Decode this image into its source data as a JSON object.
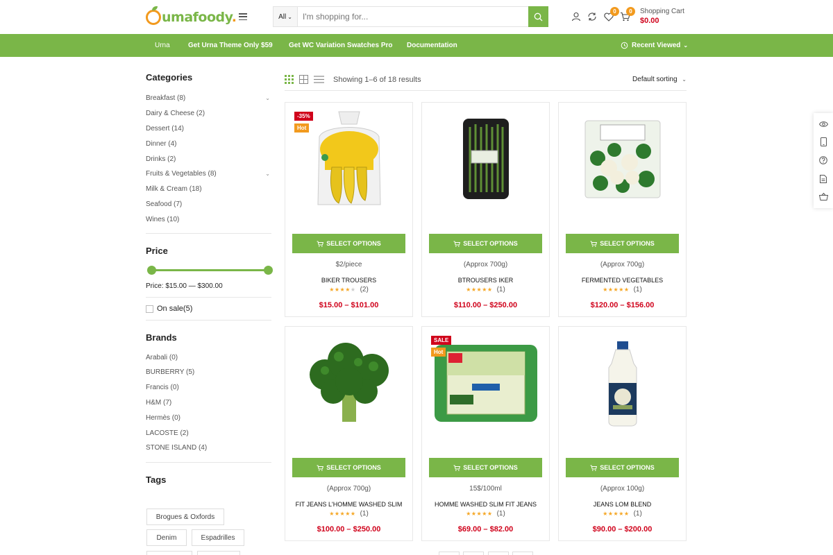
{
  "brand": {
    "name_main": "umafoody",
    "name_dot": "."
  },
  "search": {
    "category": "All",
    "placeholder": "I'm shopping for..."
  },
  "header": {
    "compare_count": "0",
    "wishlist_count": "0",
    "cart_count": "0",
    "cart_title": "Shopping Cart",
    "cart_total": "$0.00"
  },
  "nav": {
    "items": [
      "Urna",
      "Get Urna Theme Only $59",
      "Get WC Variation Swatches Pro",
      "Documentation"
    ],
    "recent": "Recent Viewed"
  },
  "sidebar": {
    "categories_title": "Categories",
    "categories": [
      {
        "label": "Breakfast (8)",
        "expandable": true
      },
      {
        "label": "Dairy & Cheese (2)",
        "expandable": false
      },
      {
        "label": "Dessert (14)",
        "expandable": false
      },
      {
        "label": "Dinner (4)",
        "expandable": false
      },
      {
        "label": "Drinks (2)",
        "expandable": false
      },
      {
        "label": "Fruits & Vegetables (8)",
        "expandable": true
      },
      {
        "label": "Milk & Cream (18)",
        "expandable": false
      },
      {
        "label": "Seafood (7)",
        "expandable": false
      },
      {
        "label": "Wines (10)",
        "expandable": false
      }
    ],
    "price_title": "Price",
    "price_range": "Price: $15.00 — $300.00",
    "on_sale": "On sale(5)",
    "brands_title": "Brands",
    "brands": [
      "Arabali (0)",
      "BURBERRY (5)",
      "Francis (0)",
      "H&M (7)",
      "Hermès (0)",
      "LACOSTE (2)",
      "STONE ISLAND (4)"
    ],
    "tags_title": "Tags",
    "tags": [
      "Brogues & Oxfords",
      "Denim",
      "Espadrilles"
    ]
  },
  "toolbar": {
    "result_count": "Showing 1–6 of 18 results",
    "sorting": "Default sorting"
  },
  "products": [
    {
      "unit": "$2/piece",
      "name": "BIKER TROUSERS",
      "rating": 4,
      "reviews": "(2)",
      "price": "$15.00 – $101.00",
      "labels": [
        "-35%",
        "Hot"
      ],
      "button": "SELECT OPTIONS"
    },
    {
      "unit": "(Approx 700g)",
      "name": "BTROUSERS IKER",
      "rating": 5,
      "reviews": "(1)",
      "price": "$110.00 – $250.00",
      "labels": [],
      "button": "SELECT OPTIONS"
    },
    {
      "unit": "(Approx 700g)",
      "name": "FERMENTED VEGETABLES",
      "rating": 5,
      "reviews": "(1)",
      "price": "$120.00 – $156.00",
      "labels": [],
      "button": "SELECT OPTIONS"
    },
    {
      "unit": "(Approx 700g)",
      "name": "FIT JEANS L'HOMME WASHED SLIM",
      "rating": 5,
      "reviews": "(1)",
      "price": "$100.00 – $250.00",
      "labels": [],
      "button": "SELECT OPTIONS"
    },
    {
      "unit": "15$/100ml",
      "name": "HOMME WASHED SLIM FIT JEANS",
      "rating": 5,
      "reviews": "(1)",
      "price": "$69.00 – $82.00",
      "labels": [
        "SALE",
        "Hot"
      ],
      "button": "SELECT OPTIONS"
    },
    {
      "unit": "(Approx 100g)",
      "name": "JEANS LOM BLEND",
      "rating": 5,
      "reviews": "(1)",
      "price": "$90.00 – $200.00",
      "labels": [],
      "button": "SELECT OPTIONS"
    }
  ],
  "colors": {
    "accent": "#7ab648",
    "sale": "#d0021b",
    "hot": "#f29a1e"
  }
}
